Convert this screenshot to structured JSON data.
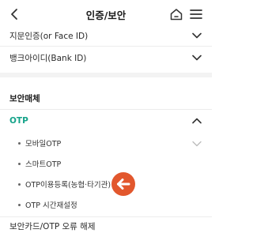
{
  "header": {
    "title": "인증/보안"
  },
  "menu": {
    "fingerprint": "지문인증(or Face ID)",
    "bankid": "뱅크아이디(Bank ID)"
  },
  "security": {
    "section_title": "보안매체",
    "otp_label": "OTP",
    "sub_items": [
      "모바일OTP",
      "스마트OTP",
      "OTP이용등록(농협·타기관)",
      "OTP 시간재설정"
    ],
    "error_reset": "보안카드/OTP 오류 해제"
  },
  "colors": {
    "accent_green": "#16a38a",
    "arrow_badge": "#e2572d",
    "icon_dark": "#333333"
  },
  "icons": {
    "back": "back-arrow-icon",
    "home": "home-icon",
    "menu": "hamburger-menu-icon",
    "expand": "chevron-down-icon",
    "collapse": "chevron-up-icon",
    "pointer": "left-arrow-icon"
  }
}
